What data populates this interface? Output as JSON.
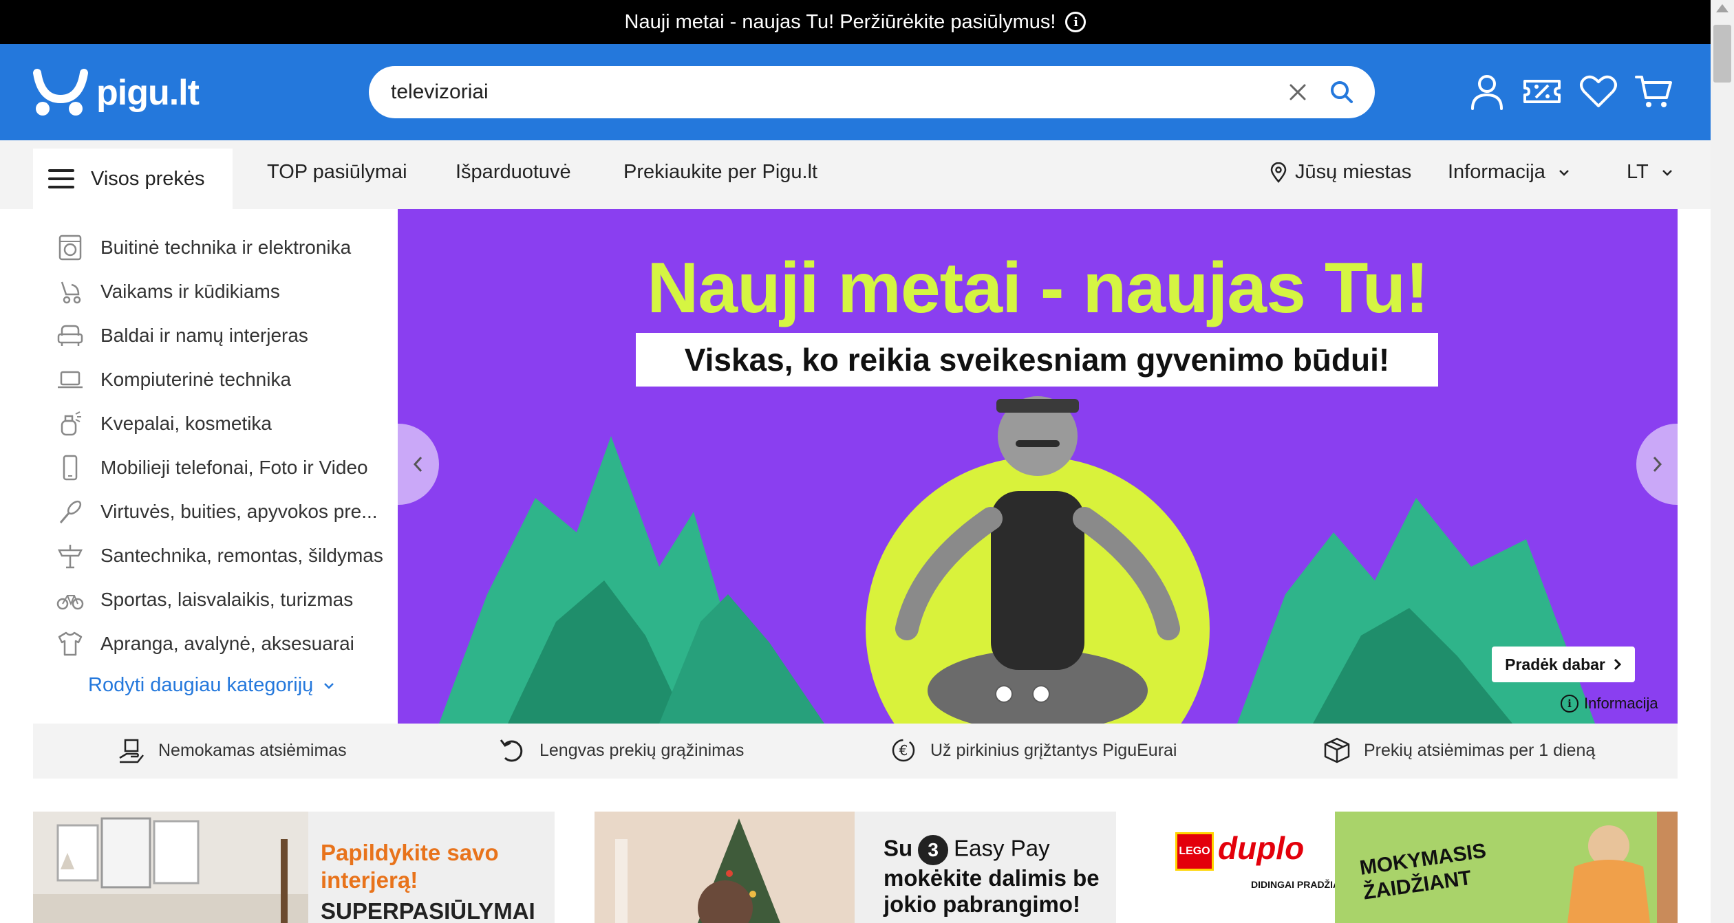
{
  "announcement": {
    "text": "Nauji metai - naujas Tu! Peržiūrėkite pasiūlymus!"
  },
  "header": {
    "logo": "pigu.lt",
    "search": {
      "value": "televizoriai",
      "placeholder": ""
    }
  },
  "nav": {
    "all_products": "Visos prekės",
    "links": [
      "TOP pasiūlymai",
      "Išparduotuvė",
      "Prekiaukite per Pigu.lt"
    ],
    "city": "Jūsų miestas",
    "info": "Informacija",
    "lang": "LT"
  },
  "categories": {
    "items": [
      "Buitinė technika ir elektronika",
      "Vaikams ir kūdikiams",
      "Baldai ir namų interjeras",
      "Kompiuterinė technika",
      "Kvepalai, kosmetika",
      "Mobilieji telefonai, Foto ir Video",
      "Virtuvės, buities, apyvokos pre...",
      "Santechnika, remontas, šildymas",
      "Sportas, laisvalaikis, turizmas",
      "Apranga, avalynė, aksesuarai"
    ],
    "more": "Rodyti daugiau kategorijų"
  },
  "hero": {
    "title": "Nauji metai - naujas Tu!",
    "subtitle": "Viskas, ko reikia sveikesniam gyvenimo būdui!",
    "cta": "Pradėk dabar",
    "info": "Informacija",
    "slide_count": 2,
    "colors": {
      "background": "#8a3ff0",
      "title": "#d5f542"
    }
  },
  "benefits": [
    "Nemokamas atsiėmimas",
    "Lengvas prekių grąžinimas",
    "Už pirkinius grįžtantys PiguEurai",
    "Prekių atsiėmimas per 1 dieną"
  ],
  "promos": {
    "interior": {
      "line1": "Papildykite savo",
      "line2": "interjerą!",
      "line3": "SUPERPASIŪLYMAI"
    },
    "easypay": {
      "su": "Su",
      "num": "3",
      "brand": "Easy Pay",
      "line2": "mokėkite dalimis be",
      "line3": "jokio pabrangimo!"
    },
    "duplo": {
      "lego": "LEGO",
      "duplo": "duplo",
      "sub": "DIDINGAI PRADŽIAI",
      "line1": "MOKYMASIS",
      "line2": "ŽAIDŽIANT"
    }
  },
  "colors": {
    "brand": "#2478dc",
    "accent_orange": "#e8731b",
    "announce_bg": "#000000"
  }
}
